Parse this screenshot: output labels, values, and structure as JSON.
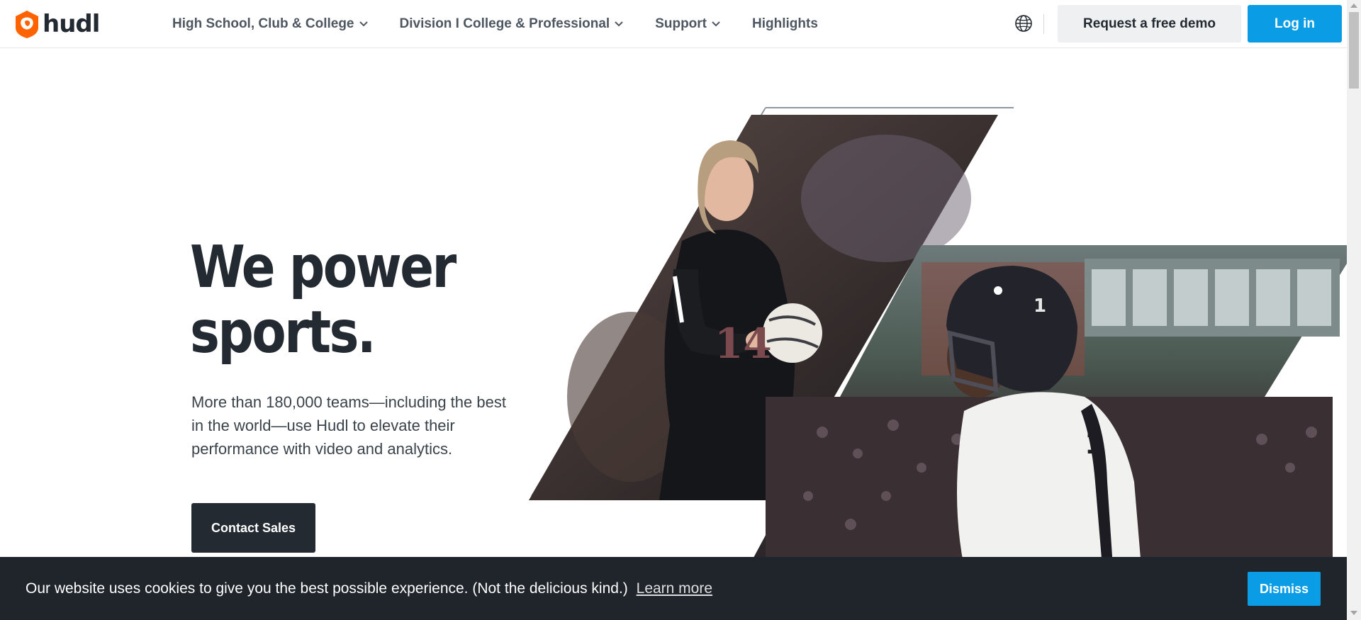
{
  "brand": {
    "name": "hudl",
    "accent": "#ff6300",
    "primary_blue": "#0a9de5",
    "dark": "#232a31"
  },
  "nav": {
    "items": [
      {
        "label": "High School, Club & College",
        "has_dropdown": true
      },
      {
        "label": "Division I College & Professional",
        "has_dropdown": true
      },
      {
        "label": "Support",
        "has_dropdown": true
      },
      {
        "label": "Highlights",
        "has_dropdown": false
      }
    ],
    "language_icon": "globe-icon",
    "demo_label": "Request a free demo",
    "login_label": "Log in"
  },
  "hero": {
    "title_line1": "We power",
    "title_line2": "sports.",
    "subtitle": "More than 180,000 teams—including the best in the world—use Hudl to elevate their performance with video and analytics.",
    "cta_label": "Contact Sales",
    "images": [
      "volleyball-player-photo",
      "football-player-photo"
    ]
  },
  "cookie_banner": {
    "message": "Our website uses cookies to give you the best possible experience. (Not the delicious kind.)",
    "link_label": "Learn more",
    "dismiss_label": "Dismiss"
  }
}
